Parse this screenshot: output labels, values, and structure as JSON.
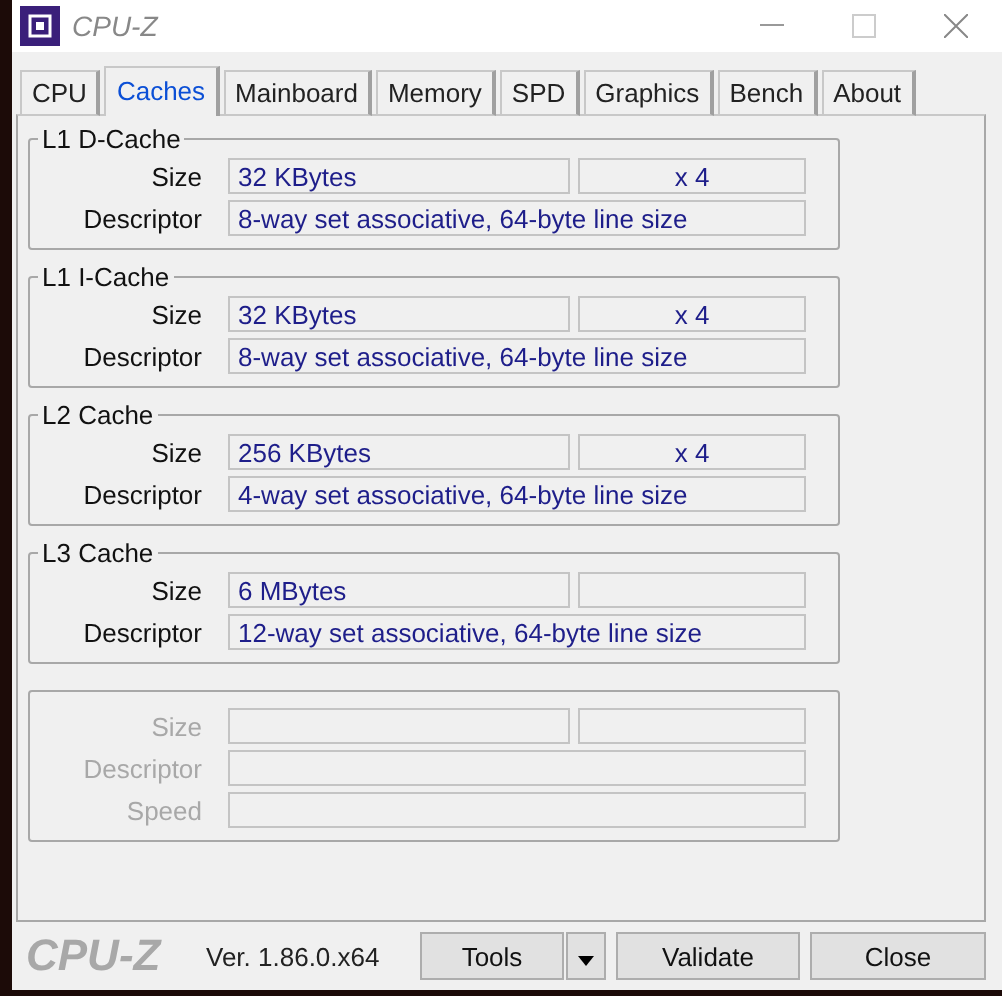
{
  "window": {
    "title": "CPU-Z"
  },
  "tabs": [
    {
      "label": "CPU",
      "selected": false
    },
    {
      "label": "Caches",
      "selected": true
    },
    {
      "label": "Mainboard",
      "selected": false
    },
    {
      "label": "Memory",
      "selected": false
    },
    {
      "label": "SPD",
      "selected": false
    },
    {
      "label": "Graphics",
      "selected": false
    },
    {
      "label": "Bench",
      "selected": false
    },
    {
      "label": "About",
      "selected": false
    }
  ],
  "groups": [
    {
      "title": "L1 D-Cache",
      "disabled": false,
      "rows": [
        {
          "kind": "split",
          "label": "Size",
          "value": "32 KBytes",
          "multiplier": "x 4"
        },
        {
          "kind": "full",
          "label": "Descriptor",
          "value": "8-way set associative, 64-byte line size"
        }
      ]
    },
    {
      "title": "L1 I-Cache",
      "disabled": false,
      "rows": [
        {
          "kind": "split",
          "label": "Size",
          "value": "32 KBytes",
          "multiplier": "x 4"
        },
        {
          "kind": "full",
          "label": "Descriptor",
          "value": "8-way set associative, 64-byte line size"
        }
      ]
    },
    {
      "title": "L2 Cache",
      "disabled": false,
      "rows": [
        {
          "kind": "split",
          "label": "Size",
          "value": "256 KBytes",
          "multiplier": "x 4"
        },
        {
          "kind": "full",
          "label": "Descriptor",
          "value": "4-way set associative, 64-byte line size"
        }
      ]
    },
    {
      "title": "L3 Cache",
      "disabled": false,
      "rows": [
        {
          "kind": "split",
          "label": "Size",
          "value": "6 MBytes"
        },
        {
          "kind": "full",
          "label": "Descriptor",
          "value": "12-way set associative, 64-byte line size"
        }
      ]
    },
    {
      "disabled": true,
      "rows": [
        {
          "kind": "split",
          "label": "Size"
        },
        {
          "kind": "full",
          "label": "Descriptor"
        },
        {
          "kind": "full",
          "label": "Speed"
        }
      ]
    }
  ],
  "footer": {
    "logo": "CPU-Z",
    "version": "Ver. 1.86.0.x64",
    "buttons": [
      "Tools",
      "Validate",
      "Close"
    ]
  }
}
